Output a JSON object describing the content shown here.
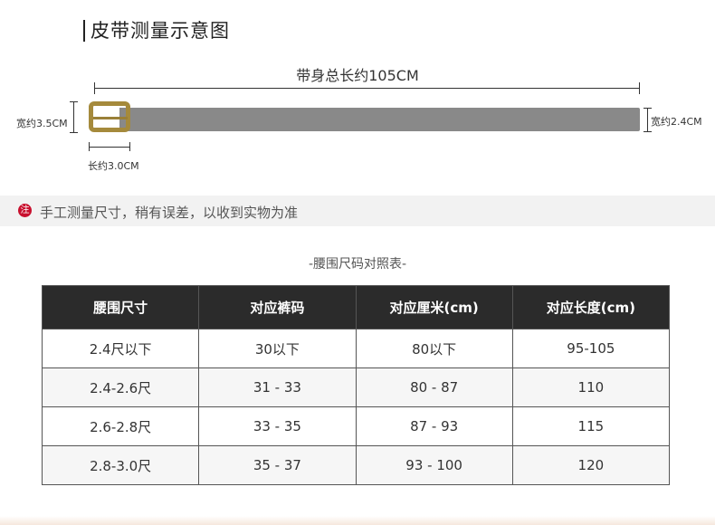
{
  "title": "皮带测量示意图",
  "diagram": {
    "total_length": "带身总长约105CM",
    "buckle_width": "宽约3.5CM",
    "strap_width": "宽约2.4CM",
    "buckle_length": "长约3.0CM"
  },
  "note": {
    "badge": "注",
    "text": "手工测量尺寸，稍有误差，以收到实物为准"
  },
  "table": {
    "title": "-腰围尺码对照表-",
    "headers": [
      "腰围尺寸",
      "对应裤码",
      "对应厘米(cm)",
      "对应长度(cm)"
    ],
    "rows": [
      [
        "2.4尺以下",
        "30以下",
        "80以下",
        "95-105"
      ],
      [
        "2.4-2.6尺",
        "31 - 33",
        "80 - 87",
        "110"
      ],
      [
        "2.6-2.8尺",
        "33 - 35",
        "87 - 93",
        "115"
      ],
      [
        "2.8-3.0尺",
        "35 - 37",
        "93 - 100",
        "120"
      ]
    ]
  },
  "colors": {
    "strap": "#898989",
    "buckle": "#a58a3c",
    "header_bg": "#2b2b2b",
    "note_badge": "#c8102e"
  }
}
